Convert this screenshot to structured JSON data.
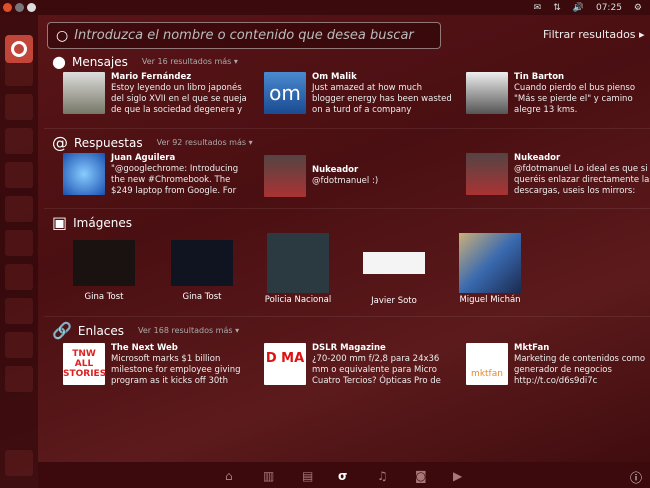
{
  "topbar": {
    "time": "07:25",
    "icons": [
      "mail-icon",
      "network-icon",
      "volume-icon",
      "gear-icon"
    ]
  },
  "search": {
    "placeholder": "Introduzca el nombre o contenido que desea buscar"
  },
  "filter_label": "Filtrar resultados ▸",
  "sections": {
    "mensajes": {
      "title": "Mensajes",
      "more": "Ver 16 resultados más ▾",
      "items": [
        {
          "name": "Mario Fernández",
          "text": "Estoy leyendo un libro japonés del siglo XVII en el que se queja de que la sociedad degenera y"
        },
        {
          "name": "Om Malik",
          "text": "Just amazed at how much blogger energy has been wasted on a turd of a company"
        },
        {
          "name": "Tin Barton",
          "text": "Cuando pierdo el bus pienso \"Más se pierde el\" y camino alegre 13 kms."
        }
      ]
    },
    "respuestas": {
      "title": "Respuestas",
      "more": "Ver 92 resultados más ▾",
      "items": [
        {
          "name": "Juan Aguilera",
          "text": "\"@googlechrome: Introducing the new #Chromebook. The $249 laptop from Google. For"
        },
        {
          "name": "Nukeador",
          "text": "@fdotmanuel :)"
        },
        {
          "name": "Nukeador",
          "text": "@fdotmanuel Lo ideal es que si queréis enlazar directamente las descargas, useis los mirrors:"
        }
      ]
    },
    "imagenes": {
      "title": "Imágenes",
      "items": [
        "Gina Tost",
        "Gina Tost",
        "Policia Nacional",
        "Javier Soto",
        "Miguel Michán"
      ]
    },
    "enlaces": {
      "title": "Enlaces",
      "more": "Ver 168 resultados más ▾",
      "items": [
        {
          "name": "The Next Web",
          "text": "Microsoft marks $1 billion milestone for employee giving program as it kicks off 30th",
          "logo": "TNW ALL STORIES"
        },
        {
          "name": "DSLR Magazine",
          "text": "¿70-200 mm f/2,8 para 24x36 mm o equivalente para Micro Cuatro Tercios? Ópticas Pro de",
          "logo": "D MA"
        },
        {
          "name": "MktFan",
          "text": "Marketing de contenidos como generador de negocios http://t.co/d6s9di7c",
          "logo": "mktfan"
        }
      ]
    }
  },
  "om_logo": "om"
}
